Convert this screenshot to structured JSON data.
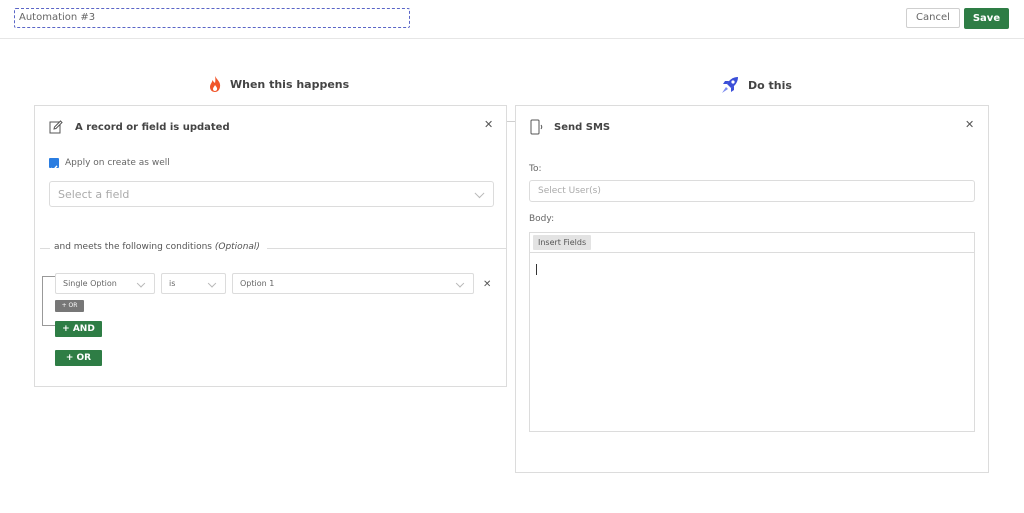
{
  "header": {
    "automation_name": "Automation #3",
    "cancel_label": "Cancel",
    "save_label": "Save"
  },
  "trigger": {
    "section_title": "When this happens",
    "section_icon": "fire-icon",
    "card_title": "A record or field is updated",
    "card_icon": "edit-icon",
    "apply_on_create_label": "Apply on create as well",
    "apply_on_create_checked": true,
    "field_select_placeholder": "Select a field",
    "conditions_label": "and meets the following conditions",
    "conditions_optional": "(Optional)",
    "condition": {
      "field": "Single Option",
      "operator": "is",
      "value": "Option 1"
    },
    "inner_or_label": "+ OR",
    "and_button_label": "+ AND",
    "or_button_label": "+ OR"
  },
  "action": {
    "section_title": "Do this",
    "section_icon": "rocket-icon",
    "card_title": "Send SMS",
    "card_icon": "phone-icon",
    "to_label": "To:",
    "to_placeholder": "Select User(s)",
    "body_label": "Body:",
    "insert_fields_label": "Insert Fields"
  },
  "colors": {
    "accent_green": "#2e7d45",
    "checkbox_blue": "#2a7de1",
    "fire_orange": "#f0552a",
    "rocket_blue": "#3b4fd8"
  }
}
